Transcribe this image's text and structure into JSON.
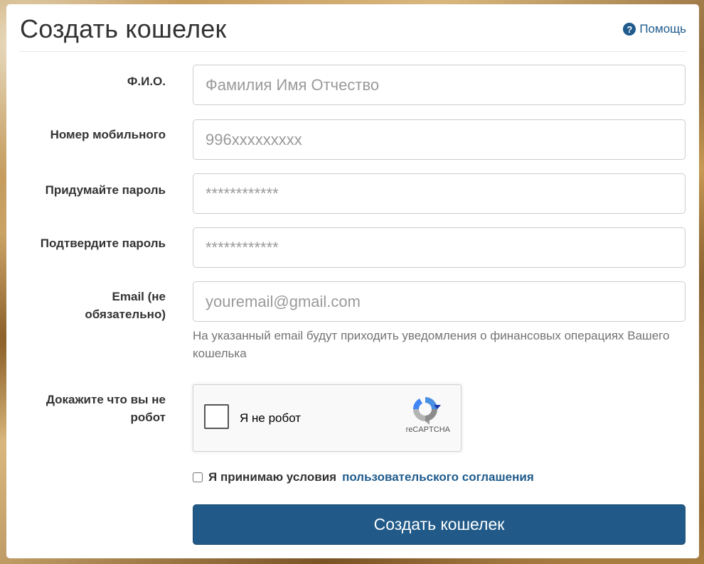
{
  "header": {
    "title": "Создать кошелек",
    "help_label": "Помощь",
    "help_icon": "question-circle-icon"
  },
  "form": {
    "fio": {
      "label": "Ф.И.О.",
      "placeholder": "Фамилия Имя Отчество"
    },
    "phone": {
      "label": "Номер мобильного",
      "placeholder": "996xxxxxxxxx"
    },
    "password": {
      "label": "Придумайте пароль",
      "placeholder": "************"
    },
    "password_confirm": {
      "label": "Подтвердите пароль",
      "placeholder": "************"
    },
    "email": {
      "label_line1": "Email (не",
      "label_line2": "обязательно)",
      "placeholder": "youremail@gmail.com",
      "hint": "На указанный email будут приходить уведомления о финансовых операциях Вашего кошелька"
    },
    "captcha": {
      "label_line1": "Докажите что вы не",
      "label_line2": "робот",
      "checkbox_text": "Я не робот",
      "brand": "reCAPTCHA",
      "checked": false
    },
    "terms": {
      "text": "Я принимаю условия",
      "link_text": "пользовательского соглашения",
      "checked": false
    },
    "submit_label": "Создать кошелек"
  },
  "colors": {
    "accent": "#215a88",
    "link": "#1f5b8c"
  }
}
